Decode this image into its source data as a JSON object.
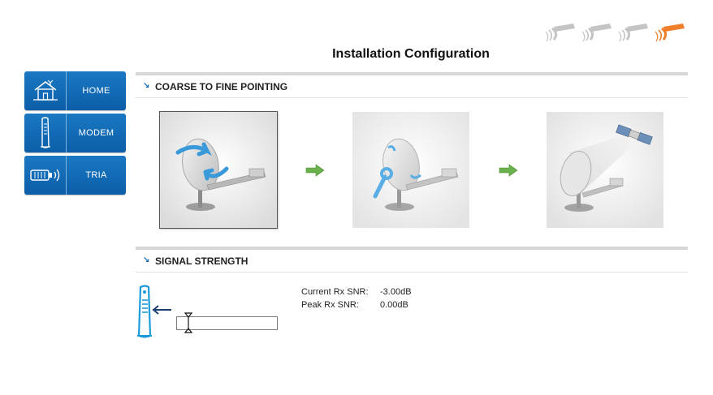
{
  "page": {
    "title": "Installation Configuration"
  },
  "steps": {
    "count": 4,
    "active_index": 3,
    "inactive_color": "#c4c4c4",
    "active_color": "#ef7f2a",
    "icon": "satellite-dish-icon"
  },
  "nav": {
    "items": [
      {
        "label": "HOME",
        "icon": "house-icon"
      },
      {
        "label": "MODEM",
        "icon": "modem-icon"
      },
      {
        "label": "TRIA",
        "icon": "tria-transceiver-icon"
      }
    ]
  },
  "sections": {
    "pointing": {
      "title": "COARSE TO FINE POINTING"
    },
    "signal": {
      "title": "SIGNAL STRENGTH"
    }
  },
  "pointing_steps": [
    {
      "name": "coarse-pointing",
      "icon": "dish-rotate-icon",
      "selected": true
    },
    {
      "name": "fine-pointing",
      "icon": "dish-wrench-icon",
      "selected": false
    },
    {
      "name": "pointed-at-satellite",
      "icon": "dish-satellite-icon",
      "selected": false
    }
  ],
  "signal": {
    "current_label": "Current Rx SNR:",
    "current_value": "-3.00dB",
    "peak_label": "Peak Rx SNR:",
    "peak_value": "0.00dB",
    "bar_level_fraction": 0.0,
    "marker_fraction": 0.12
  },
  "colors": {
    "nav_blue": "#0c5ea8",
    "accent_blue": "#1b6fb5",
    "arrow_green": "#6ab04c",
    "step_orange": "#ef7f2a"
  }
}
